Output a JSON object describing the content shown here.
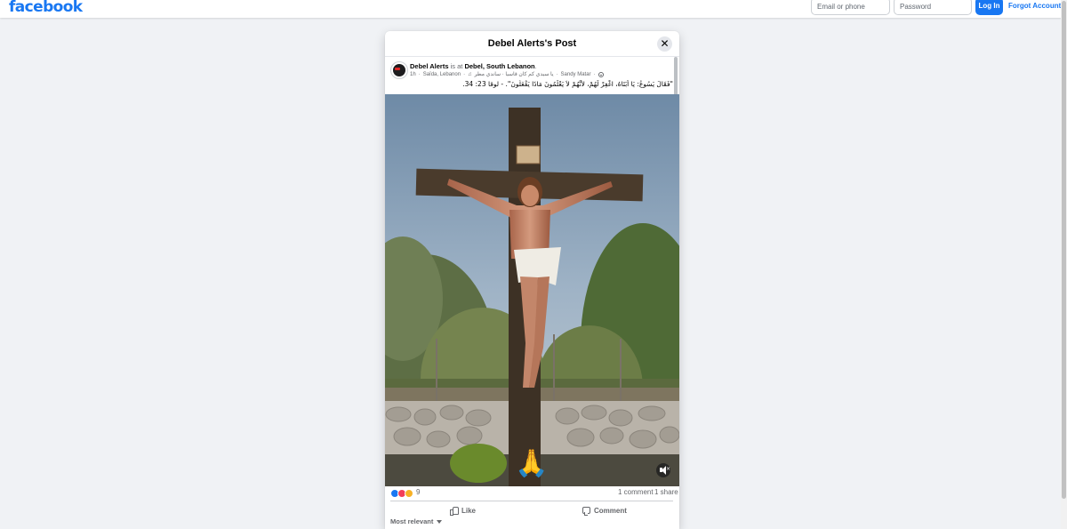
{
  "header": {
    "logo": "facebook",
    "email_placeholder": "Email or phone",
    "password_placeholder": "Password",
    "login_label": "Log In",
    "forgot_label": "Forgot Account?"
  },
  "modal": {
    "title": "Debel Alerts's Post",
    "close_icon": "close-icon"
  },
  "post": {
    "author": "Debel Alerts",
    "at_text": "is at",
    "place": "Debel, South Lebanon",
    "place_suffix": ".",
    "meta": {
      "time": "1h",
      "location": "Saïda, Lebanon",
      "song": "يا سيدي كم كان قاسياً · ساندي مطر",
      "artist": "Sandy Matar"
    },
    "caption": "\"فَقَالَ يَسُوعُ: يَا أَبَتَاهُ، اغْفِرْ لَهُمْ، لأَنَّهُمْ لاَ يَعْلَمُونَ مَاذَا يَفْعَلُونَ\". - لوقا 23: 34.",
    "emoji_overlay": "🙏"
  },
  "engagement": {
    "reaction_count": "9",
    "comments": "1 comment",
    "shares": "1 share",
    "like_label": "Like",
    "comment_label": "Comment",
    "sort_label": "Most relevant"
  },
  "colors": {
    "brand": "#1877f2",
    "page_bg": "#f0f2f5"
  }
}
